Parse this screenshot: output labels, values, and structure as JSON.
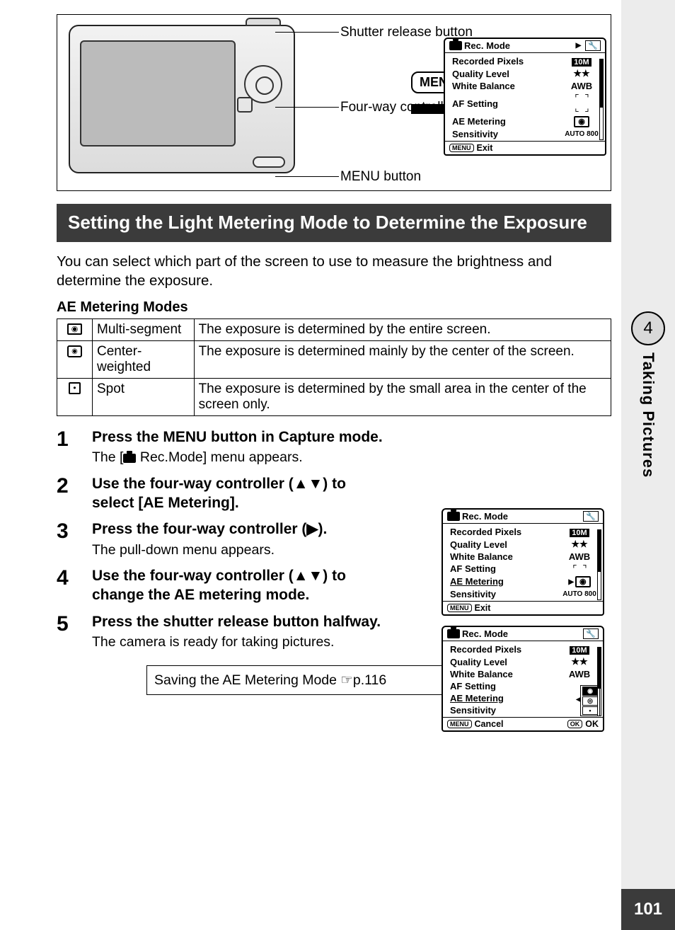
{
  "callouts": {
    "shutter": "Shutter release button",
    "fourway": "Four-way controller",
    "menubtn": "MENU button",
    "menu_pill": "MENU"
  },
  "lcd": {
    "tab1": "Rec. Mode",
    "tab2_icon": "✕",
    "rows": {
      "recorded_pixels": "Recorded Pixels",
      "quality_level": "Quality Level",
      "white_balance": "White Balance",
      "af_setting": "AF Setting",
      "ae_metering": "AE Metering",
      "sensitivity": "Sensitivity"
    },
    "vals": {
      "recorded_pixels": "10M",
      "quality_level": "★★",
      "white_balance": "AWB",
      "sensitivity": "AUTO 800"
    },
    "foot_exit": "Exit",
    "foot_cancel": "Cancel",
    "foot_ok": "OK"
  },
  "section_title": "Setting the Light Metering Mode to Determine the Exposure",
  "intro": "You can select which part of the screen to use to measure the brightness and determine the exposure.",
  "subhead": "AE Metering Modes",
  "modes": [
    {
      "name": "Multi-segment",
      "desc": "The exposure is determined by the entire screen."
    },
    {
      "name": "Center-weighted",
      "desc": "The exposure is determined mainly by the center of the screen."
    },
    {
      "name": "Spot",
      "desc": "The exposure is determined by the small area in the center of the screen only."
    }
  ],
  "steps": {
    "s1": {
      "num": "1",
      "head": "Press the MENU button in Capture mode.",
      "sub": "Rec.Mode] menu appears.",
      "sub_prefix": "The ["
    },
    "s2": {
      "num": "2",
      "head": "Use the four-way controller (▲▼) to select [AE Metering]."
    },
    "s3": {
      "num": "3",
      "head": "Press the four-way controller (▶).",
      "sub": "The pull-down menu appears."
    },
    "s4": {
      "num": "4",
      "head": "Use the four-way controller (▲▼) to change the AE metering mode."
    },
    "s5": {
      "num": "5",
      "head": "Press the shutter release button halfway.",
      "sub": "The camera is ready for taking pictures."
    }
  },
  "crossref": "Saving the AE Metering Mode ☞p.116",
  "side": {
    "chapter_num": "4",
    "chapter_title": "Taking Pictures"
  },
  "page_number": "101"
}
